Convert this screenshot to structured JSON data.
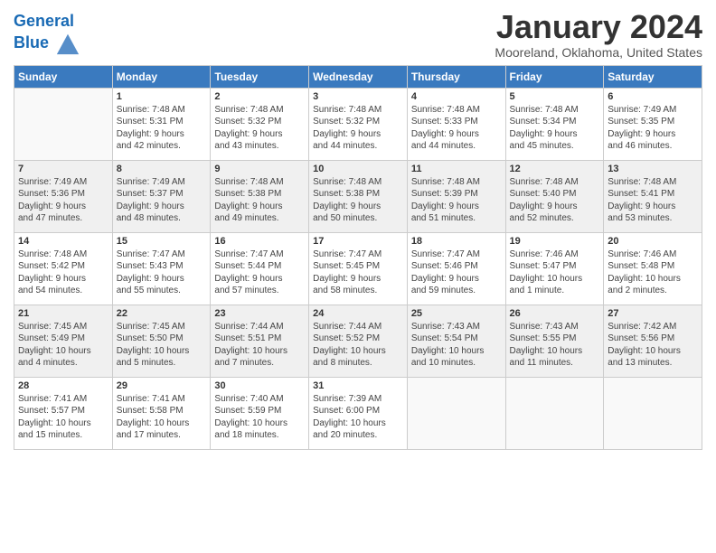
{
  "logo": {
    "line1": "General",
    "line2": "Blue"
  },
  "title": "January 2024",
  "location": "Mooreland, Oklahoma, United States",
  "days_of_week": [
    "Sunday",
    "Monday",
    "Tuesday",
    "Wednesday",
    "Thursday",
    "Friday",
    "Saturday"
  ],
  "weeks": [
    [
      {
        "day": "",
        "content": ""
      },
      {
        "day": "1",
        "content": "Sunrise: 7:48 AM\nSunset: 5:31 PM\nDaylight: 9 hours\nand 42 minutes."
      },
      {
        "day": "2",
        "content": "Sunrise: 7:48 AM\nSunset: 5:32 PM\nDaylight: 9 hours\nand 43 minutes."
      },
      {
        "day": "3",
        "content": "Sunrise: 7:48 AM\nSunset: 5:32 PM\nDaylight: 9 hours\nand 44 minutes."
      },
      {
        "day": "4",
        "content": "Sunrise: 7:48 AM\nSunset: 5:33 PM\nDaylight: 9 hours\nand 44 minutes."
      },
      {
        "day": "5",
        "content": "Sunrise: 7:48 AM\nSunset: 5:34 PM\nDaylight: 9 hours\nand 45 minutes."
      },
      {
        "day": "6",
        "content": "Sunrise: 7:49 AM\nSunset: 5:35 PM\nDaylight: 9 hours\nand 46 minutes."
      }
    ],
    [
      {
        "day": "7",
        "content": "Sunrise: 7:49 AM\nSunset: 5:36 PM\nDaylight: 9 hours\nand 47 minutes."
      },
      {
        "day": "8",
        "content": "Sunrise: 7:49 AM\nSunset: 5:37 PM\nDaylight: 9 hours\nand 48 minutes."
      },
      {
        "day": "9",
        "content": "Sunrise: 7:48 AM\nSunset: 5:38 PM\nDaylight: 9 hours\nand 49 minutes."
      },
      {
        "day": "10",
        "content": "Sunrise: 7:48 AM\nSunset: 5:38 PM\nDaylight: 9 hours\nand 50 minutes."
      },
      {
        "day": "11",
        "content": "Sunrise: 7:48 AM\nSunset: 5:39 PM\nDaylight: 9 hours\nand 51 minutes."
      },
      {
        "day": "12",
        "content": "Sunrise: 7:48 AM\nSunset: 5:40 PM\nDaylight: 9 hours\nand 52 minutes."
      },
      {
        "day": "13",
        "content": "Sunrise: 7:48 AM\nSunset: 5:41 PM\nDaylight: 9 hours\nand 53 minutes."
      }
    ],
    [
      {
        "day": "14",
        "content": "Sunrise: 7:48 AM\nSunset: 5:42 PM\nDaylight: 9 hours\nand 54 minutes."
      },
      {
        "day": "15",
        "content": "Sunrise: 7:47 AM\nSunset: 5:43 PM\nDaylight: 9 hours\nand 55 minutes."
      },
      {
        "day": "16",
        "content": "Sunrise: 7:47 AM\nSunset: 5:44 PM\nDaylight: 9 hours\nand 57 minutes."
      },
      {
        "day": "17",
        "content": "Sunrise: 7:47 AM\nSunset: 5:45 PM\nDaylight: 9 hours\nand 58 minutes."
      },
      {
        "day": "18",
        "content": "Sunrise: 7:47 AM\nSunset: 5:46 PM\nDaylight: 9 hours\nand 59 minutes."
      },
      {
        "day": "19",
        "content": "Sunrise: 7:46 AM\nSunset: 5:47 PM\nDaylight: 10 hours\nand 1 minute."
      },
      {
        "day": "20",
        "content": "Sunrise: 7:46 AM\nSunset: 5:48 PM\nDaylight: 10 hours\nand 2 minutes."
      }
    ],
    [
      {
        "day": "21",
        "content": "Sunrise: 7:45 AM\nSunset: 5:49 PM\nDaylight: 10 hours\nand 4 minutes."
      },
      {
        "day": "22",
        "content": "Sunrise: 7:45 AM\nSunset: 5:50 PM\nDaylight: 10 hours\nand 5 minutes."
      },
      {
        "day": "23",
        "content": "Sunrise: 7:44 AM\nSunset: 5:51 PM\nDaylight: 10 hours\nand 7 minutes."
      },
      {
        "day": "24",
        "content": "Sunrise: 7:44 AM\nSunset: 5:52 PM\nDaylight: 10 hours\nand 8 minutes."
      },
      {
        "day": "25",
        "content": "Sunrise: 7:43 AM\nSunset: 5:54 PM\nDaylight: 10 hours\nand 10 minutes."
      },
      {
        "day": "26",
        "content": "Sunrise: 7:43 AM\nSunset: 5:55 PM\nDaylight: 10 hours\nand 11 minutes."
      },
      {
        "day": "27",
        "content": "Sunrise: 7:42 AM\nSunset: 5:56 PM\nDaylight: 10 hours\nand 13 minutes."
      }
    ],
    [
      {
        "day": "28",
        "content": "Sunrise: 7:41 AM\nSunset: 5:57 PM\nDaylight: 10 hours\nand 15 minutes."
      },
      {
        "day": "29",
        "content": "Sunrise: 7:41 AM\nSunset: 5:58 PM\nDaylight: 10 hours\nand 17 minutes."
      },
      {
        "day": "30",
        "content": "Sunrise: 7:40 AM\nSunset: 5:59 PM\nDaylight: 10 hours\nand 18 minutes."
      },
      {
        "day": "31",
        "content": "Sunrise: 7:39 AM\nSunset: 6:00 PM\nDaylight: 10 hours\nand 20 minutes."
      },
      {
        "day": "",
        "content": ""
      },
      {
        "day": "",
        "content": ""
      },
      {
        "day": "",
        "content": ""
      }
    ]
  ]
}
